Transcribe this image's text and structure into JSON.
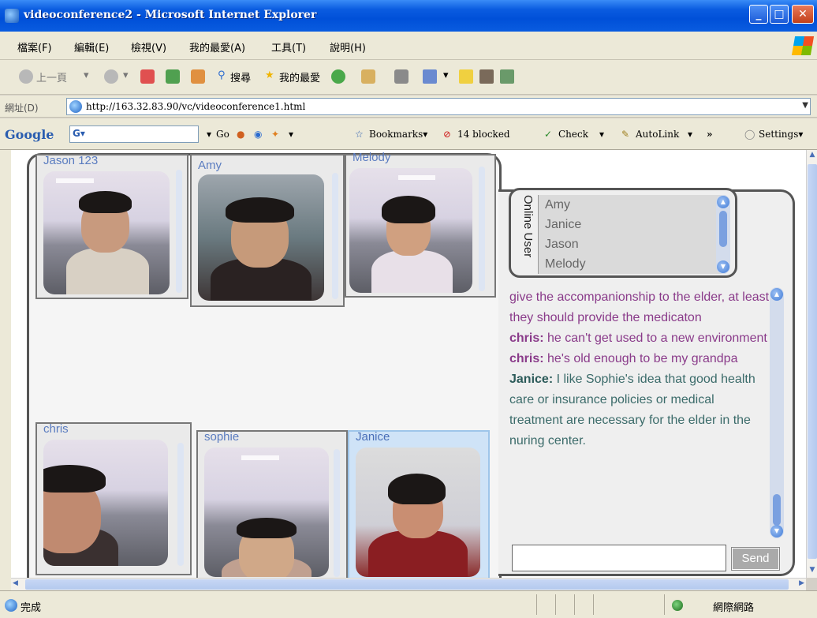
{
  "window": {
    "title": "videoconference2 - Microsoft Internet Explorer"
  },
  "menu": {
    "items": [
      "檔案(F)",
      "編輯(E)",
      "檢視(V)",
      "我的最愛(A)",
      "工具(T)",
      "說明(H)"
    ]
  },
  "toolbar": {
    "back": "上一頁",
    "search": "搜尋",
    "favorites": "我的最愛"
  },
  "address": {
    "label": "網址(D)",
    "url": "http://163.32.83.90/vc/videoconference1.html"
  },
  "google_bar": {
    "logo": "Google",
    "go": "Go",
    "bookmarks": "Bookmarks",
    "blocked": "14 blocked",
    "check": "Check",
    "autolink": "AutoLink",
    "more": "»",
    "settings": "Settings"
  },
  "video": {
    "tiles": [
      {
        "name": "Jason 123"
      },
      {
        "name": "Amy"
      },
      {
        "name": "Melody"
      },
      {
        "name": "chris"
      },
      {
        "name": "sophie"
      },
      {
        "name": "Janice"
      }
    ]
  },
  "online": {
    "label": "Online User",
    "users": [
      "Amy",
      "Janice",
      "Jason",
      "Melody"
    ]
  },
  "chat": {
    "lines": [
      {
        "who": "",
        "text": "give the accompanionship to the elder, at least they should provide the medicaton"
      },
      {
        "who": "chris:",
        "text": " he can't get used to a new environment"
      },
      {
        "who": "chris:",
        "text": " he's old enough to be my grandpa"
      },
      {
        "who": "Janice:",
        "text": " I like Sophie's idea that good health care or insurance policies or medical treatment are necessary for the elder in the nuring center."
      }
    ],
    "send_label": "Send",
    "input_value": ""
  },
  "status": {
    "text": "完成",
    "zone": "網際網路"
  }
}
